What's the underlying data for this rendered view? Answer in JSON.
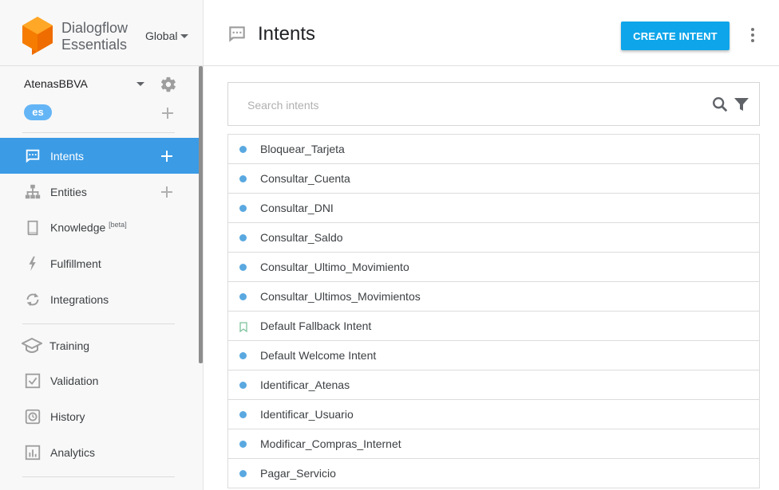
{
  "brand": {
    "name_line1": "Dialogflow",
    "name_line2": "Essentials",
    "region": "Global"
  },
  "agent": {
    "name": "AtenasBBVA",
    "language": "es"
  },
  "nav": {
    "intents": "Intents",
    "entities": "Entities",
    "knowledge": "Knowledge",
    "knowledge_badge": "[beta]",
    "fulfillment": "Fulfillment",
    "integrations": "Integrations",
    "training": "Training",
    "validation": "Validation",
    "history": "History",
    "analytics": "Analytics"
  },
  "header": {
    "title": "Intents",
    "create_button": "CREATE INTENT"
  },
  "search": {
    "placeholder": "Search intents",
    "value": ""
  },
  "intents": [
    {
      "label": "Bloquear_Tarjeta",
      "marker": "dot"
    },
    {
      "label": "Consultar_Cuenta",
      "marker": "dot"
    },
    {
      "label": "Consultar_DNI",
      "marker": "dot"
    },
    {
      "label": "Consultar_Saldo",
      "marker": "dot"
    },
    {
      "label": "Consultar_Ultimo_Movimiento",
      "marker": "dot"
    },
    {
      "label": "Consultar_Ultimos_Movimientos",
      "marker": "dot"
    },
    {
      "label": "Default Fallback Intent",
      "marker": "bookmark"
    },
    {
      "label": "Default Welcome Intent",
      "marker": "dot"
    },
    {
      "label": "Identificar_Atenas",
      "marker": "dot"
    },
    {
      "label": "Identificar_Usuario",
      "marker": "dot"
    },
    {
      "label": "Modificar_Compras_Internet",
      "marker": "dot"
    },
    {
      "label": "Pagar_Servicio",
      "marker": "dot"
    }
  ],
  "colors": {
    "accent": "#0ea5ea",
    "active_nav": "#3b9be5",
    "dot": "#5aa8e0",
    "logo": "#ff9800",
    "bookmark": "#7cc29a"
  }
}
